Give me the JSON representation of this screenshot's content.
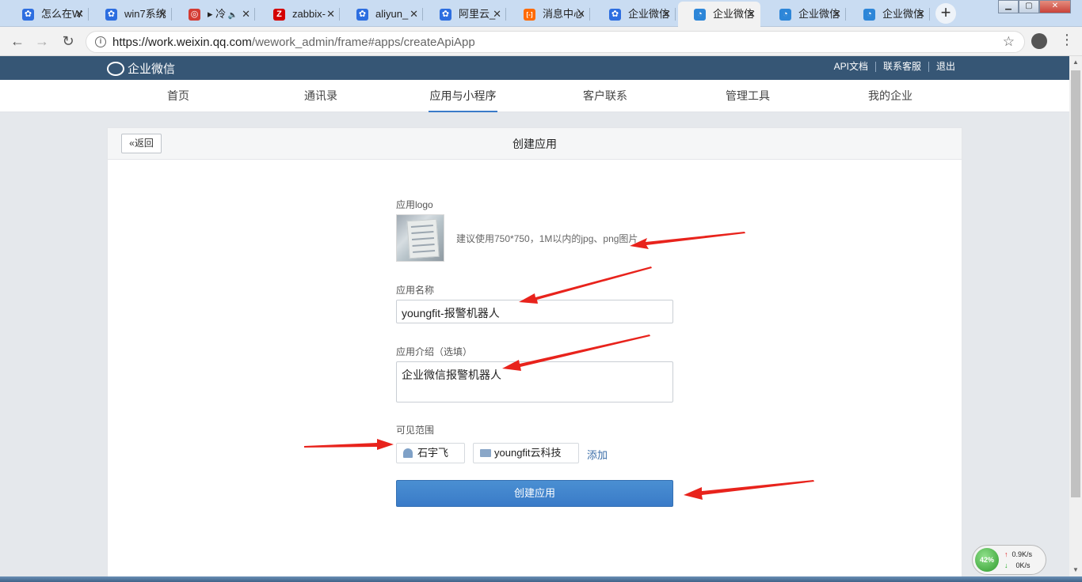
{
  "browser": {
    "tabs": [
      {
        "title": "怎么在W",
        "icon": "baidu-paw-icon",
        "color": "#2d6ee0"
      },
      {
        "title": "win7系统",
        "icon": "baidu-paw-icon",
        "color": "#2d6ee0"
      },
      {
        "title": "▸ 冷",
        "icon": "netease-music-icon",
        "color": "#d43c33",
        "extra": "speaker-icon"
      },
      {
        "title": "zabbix-",
        "icon": "zabbix-z-icon",
        "color": "#d40000"
      },
      {
        "title": "aliyun_",
        "icon": "baidu-paw-icon",
        "color": "#2d6ee0"
      },
      {
        "title": "阿里云_",
        "icon": "baidu-paw-icon",
        "color": "#2d6ee0"
      },
      {
        "title": "消息中心",
        "icon": "aliyun-bracket-icon",
        "color": "#ff6a00"
      },
      {
        "title": "企业微信",
        "icon": "baidu-paw-icon",
        "color": "#2d6ee0"
      },
      {
        "title": "企业微信",
        "icon": "wework-icon",
        "color": "#2d86d8",
        "active": true
      },
      {
        "title": "企业微信",
        "icon": "wework-icon",
        "color": "#2d86d8"
      },
      {
        "title": "企业微信",
        "icon": "wework-icon",
        "color": "#2d86d8"
      }
    ],
    "url_host": "https://work.weixin.qq.com",
    "url_path": "/wework_admin/frame#apps/createApiApp"
  },
  "header": {
    "brand": "企业微信",
    "links": [
      "API文档",
      "联系客服",
      "退出"
    ]
  },
  "nav": {
    "items": [
      "首页",
      "通讯录",
      "应用与小程序",
      "客户联系",
      "管理工具",
      "我的企业"
    ],
    "active_index": 2
  },
  "form": {
    "back_label": "返回",
    "title": "创建应用",
    "logo_label": "应用logo",
    "logo_hint": "建议使用750*750，1M以内的jpg、png图片",
    "name_label": "应用名称",
    "name_value": "youngfit-报警机器人",
    "intro_label": "应用介绍（选填）",
    "intro_value": "企业微信报警机器人",
    "scope_label": "可见范围",
    "scope_person": "石宇飞",
    "scope_dept": "youngfit云科技",
    "add_label": "添加",
    "submit_label": "创建应用"
  },
  "netmeter": {
    "percent": "42%",
    "upload": "0.9K/s",
    "download": "0K/s"
  },
  "colors": {
    "topbar": "#365675",
    "primary": "#3a7bc8",
    "annotation_arrow": "#e8231c"
  }
}
